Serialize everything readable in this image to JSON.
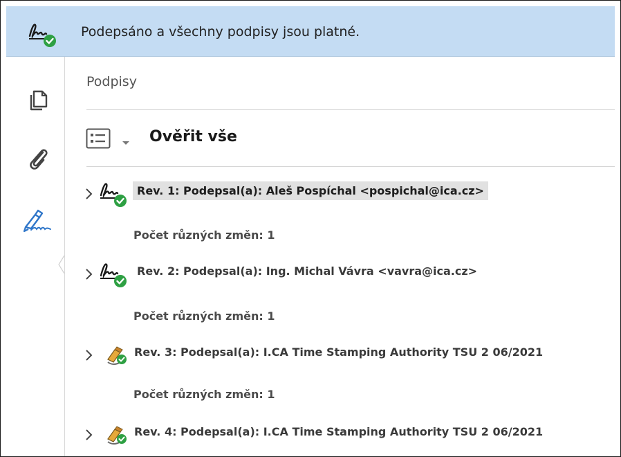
{
  "banner": {
    "message": "Podepsáno a všechny podpisy jsou platné.",
    "icon": "signature-valid-icon"
  },
  "rail": {
    "items": [
      {
        "icon": "pages-icon"
      },
      {
        "icon": "attachment-icon"
      },
      {
        "icon": "signature-panel-icon",
        "active": true
      }
    ]
  },
  "panel": {
    "title": "Podpisy",
    "toolbar": {
      "menu_icon": "list-options-icon",
      "verify_all": "Ověřit vše"
    },
    "revisions": [
      {
        "label": "Rev. 1: Podepsal(a): Aleš Pospíchal <pospichal@ica.cz>",
        "icon": "signature-valid-icon",
        "changes": "Počet různých změn: 1",
        "selected": true
      },
      {
        "label": "Rev. 2: Podepsal(a): Ing. Michal Vávra <vavra@ica.cz>",
        "icon": "signature-valid-icon",
        "changes": "Počet různých změn: 1",
        "selected": false
      },
      {
        "label": "Rev. 3: Podepsal(a): I.CA Time Stamping Authority TSU 2 06/2021",
        "icon": "timestamp-valid-icon",
        "changes": "Počet různých změn: 1",
        "selected": false
      },
      {
        "label": "Rev. 4: Podepsal(a): I.CA Time Stamping Authority TSU 2 06/2021",
        "icon": "timestamp-valid-icon",
        "changes": "",
        "selected": false
      }
    ]
  },
  "colors": {
    "banner_bg": "#c4dcf3",
    "valid_green": "#2ea043",
    "accent_blue": "#2f76c9",
    "selected_row": "#e1e1e1"
  }
}
